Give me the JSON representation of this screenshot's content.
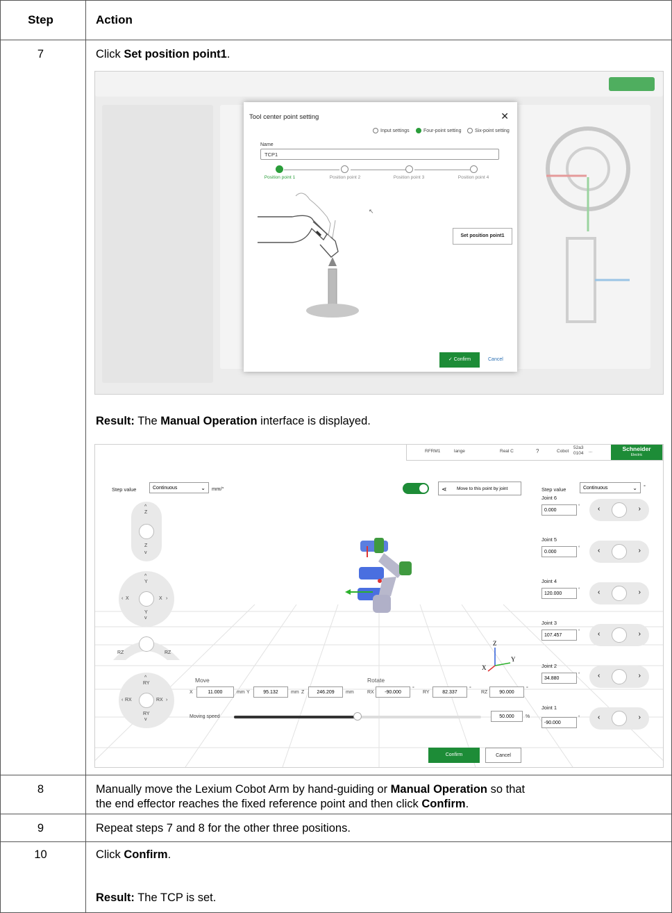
{
  "table": {
    "headers": {
      "step": "Step",
      "action": "Action"
    },
    "rows": [
      {
        "step": "7",
        "text_before": "Click ",
        "bold": "Set position point1",
        "text_after": ".",
        "result_label": "Result:",
        "result_pre": " The ",
        "result_bold": "Manual Operation",
        "result_post": " interface is displayed."
      },
      {
        "step": "8",
        "line1_pre": "Manually move the Lexium Cobot Arm by hand-guiding or ",
        "line1_bold": "Manual Operation",
        "line1_post": " so that",
        "line2_pre": "the end effector reaches the fixed reference point and then click ",
        "line2_bold": "Confirm",
        "line2_post": "."
      },
      {
        "step": "9",
        "text": "Repeat steps 7 and 8 for the other three positions."
      },
      {
        "step": "10",
        "text_before": "Click ",
        "bold": "Confirm",
        "text_after": ".",
        "result_label": "Result:",
        "result_text": " The TCP is set."
      }
    ]
  },
  "shot1": {
    "title": "Tool center point setting",
    "close": "✕",
    "modes": [
      "Input settings",
      "Four-point setting",
      "Six-point setting"
    ],
    "selected_mode": "Four-point setting",
    "name_label": "Name",
    "name_value": "TCP1",
    "points": [
      "Position point 1",
      "Position point 2",
      "Position point 3",
      "Position point 4"
    ],
    "set_button": "Set position point1",
    "confirm": "✓  Confirm",
    "cancel": "Cancel",
    "colors": {
      "accent": "#2a9d3a",
      "confirm": "#1d8c37"
    }
  },
  "shot2": {
    "toolbar": [
      "RFRM1",
      "lange",
      "Real C",
      "?",
      "Cobot",
      "52a3",
      "0104",
      "..."
    ],
    "brand": "Schneider",
    "brand_sub": "Electric",
    "step_value_label": "Step value",
    "step_value": "Continuous",
    "unit": "mm/°",
    "move_joint_btn": "Move to this point by joint",
    "right_step_label": "Step value",
    "right_step_value": "Continuous",
    "deg": "°",
    "joints": [
      {
        "label": "Joint 6",
        "value": "0.000"
      },
      {
        "label": "Joint 5",
        "value": "0.000"
      },
      {
        "label": "Joint 4",
        "value": "120.000"
      },
      {
        "label": "Joint 3",
        "value": "107.457"
      },
      {
        "label": "Joint 2",
        "value": "34.880"
      },
      {
        "label": "Joint 1",
        "value": "-90.000"
      }
    ],
    "pads": {
      "z_up": "Z",
      "z_down": "Z",
      "y_up": "Y",
      "y_down": "Y",
      "x_left": "X",
      "x_right": "X",
      "rz_left": "RZ",
      "rz_right": "RZ",
      "ry_up": "RY",
      "ry_down": "RY",
      "rx_left": "RX",
      "rx_right": "RX"
    },
    "move_label": "Move",
    "rotate_label": "Rotate",
    "move": {
      "x": "11.000",
      "y": "95.132",
      "z": "246.209",
      "unit": "mm"
    },
    "rotate": {
      "rx": "-90.000",
      "ry": "82.337",
      "rz": "90.000"
    },
    "axis_labels": {
      "x": "X",
      "y": "Y",
      "z": "Z",
      "rx": "RX",
      "ry": "RY",
      "rz": "RZ"
    },
    "speed_label": "Moving speed",
    "speed_value": "50.000",
    "speed_unit": "%",
    "speed_fraction": 0.5,
    "confirm": "Confirm",
    "cancel": "Cancel",
    "colors": {
      "accent": "#1d8c37",
      "brand": "#3dcd58"
    }
  }
}
